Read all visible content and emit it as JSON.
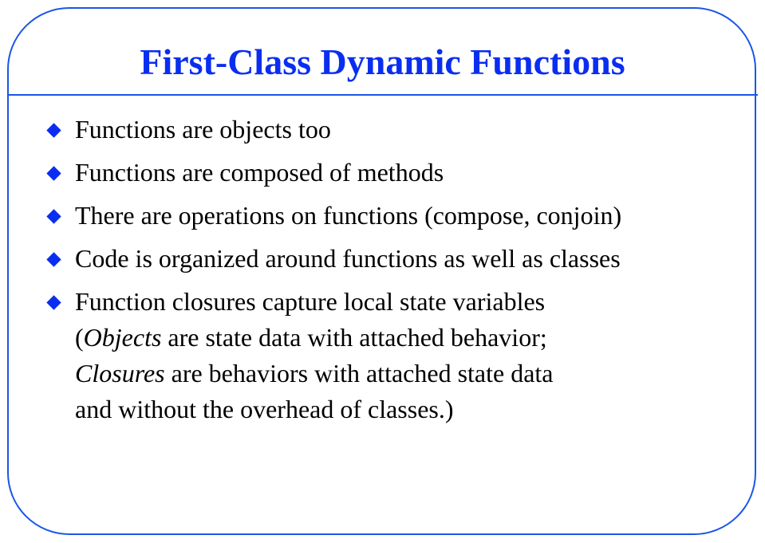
{
  "slide": {
    "title": "First-Class Dynamic Functions",
    "accent_color": "#0a2ef0",
    "frame_color": "#1a56e8",
    "bullet_icon": "diamond-bullet-icon",
    "bullets": [
      {
        "text": "Functions are objects too"
      },
      {
        "text": "Functions are composed of methods"
      },
      {
        "text": "There are operations on functions (compose, conjoin)"
      },
      {
        "text": "Code is organized around functions as well as classes"
      },
      {
        "text": "Function closures capture local state variables",
        "continuation": {
          "open_paren": "(",
          "objects_term": "Objects",
          "objects_rest": " are state data with attached behavior;",
          "closures_term": "Closures",
          "closures_rest": " are behaviors with attached state data",
          "last_line": "and without the overhead of classes.)"
        }
      }
    ]
  }
}
